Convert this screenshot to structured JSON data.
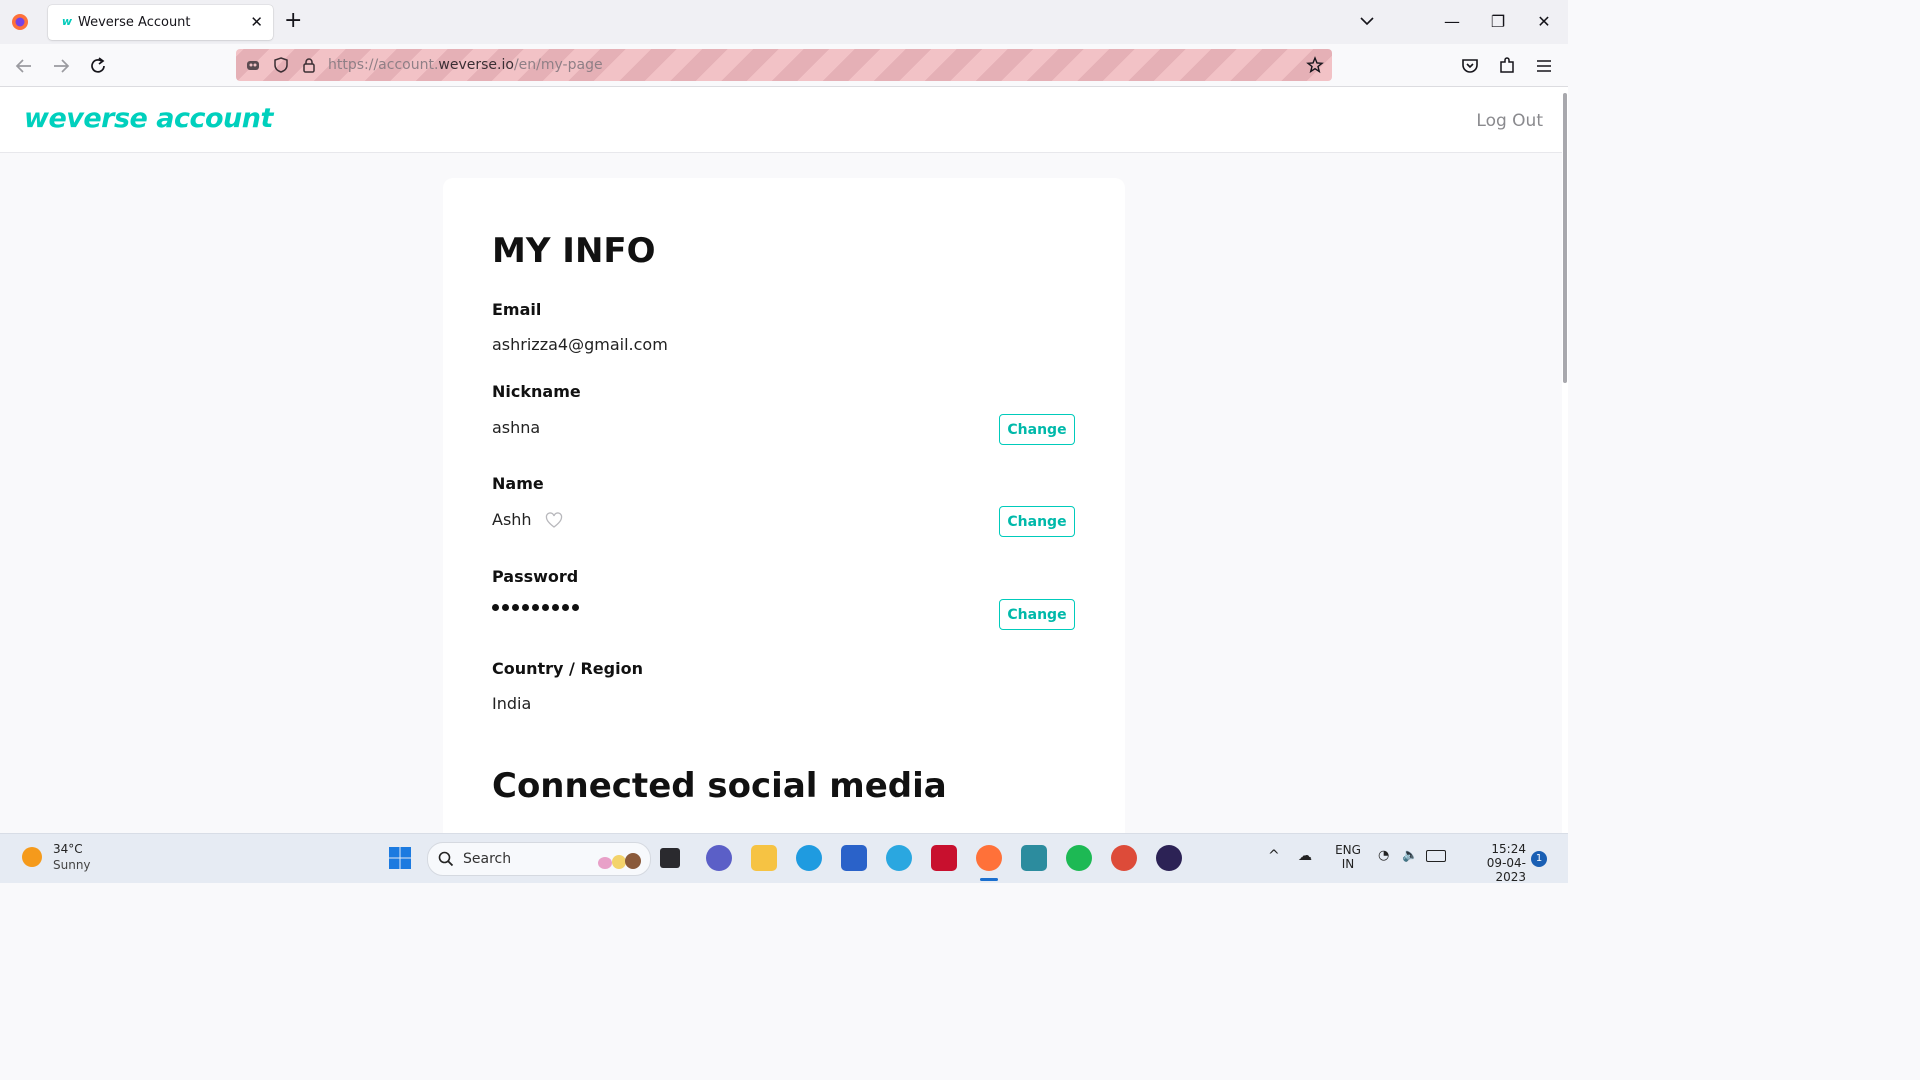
{
  "browser": {
    "tab_title": "Weverse Account",
    "tab_favicon": "w",
    "url_prefix": "https://account.",
    "url_domain": "weverse.io",
    "url_path": "/en/my-page"
  },
  "site": {
    "logo": "weverse account",
    "logout_label": "Log Out",
    "accent_color": "#00cbbb"
  },
  "my_info": {
    "title": "MY INFO",
    "email_label": "Email",
    "email_value": "ashrizza4@gmail.com",
    "nickname_label": "Nickname",
    "nickname_value": "ashna",
    "name_label": "Name",
    "name_value": "Ashh",
    "password_label": "Password",
    "country_label": "Country / Region",
    "country_value": "India",
    "change_label": "Change"
  },
  "social": {
    "title": "Connected social media"
  },
  "taskbar": {
    "weather_temp": "34°C",
    "weather_cond": "Sunny",
    "search_label": "Search",
    "lang_line1": "ENG",
    "lang_line2": "IN",
    "time": "15:24",
    "date": "09-04-2023",
    "notification_count": "1"
  }
}
